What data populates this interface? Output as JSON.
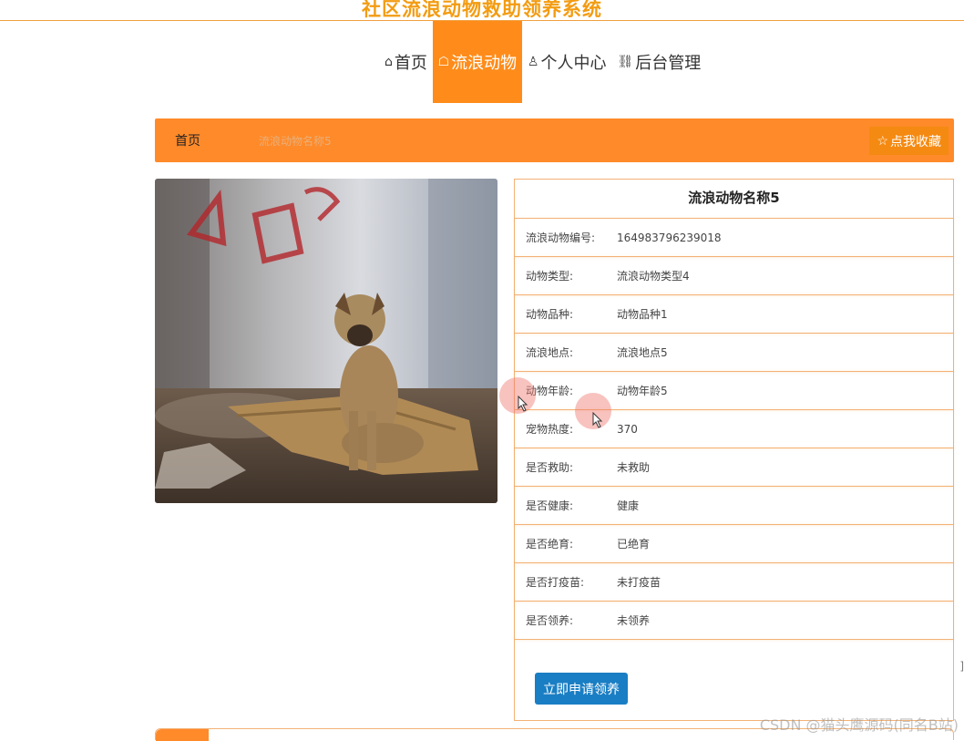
{
  "header": {
    "site_title": "社区流浪动物救助领养系统"
  },
  "nav": {
    "items": [
      {
        "label": "首页",
        "icon": "home-icon",
        "active": false
      },
      {
        "label": "流浪动物",
        "icon": "paw-icon",
        "active": true
      },
      {
        "label": "个人中心",
        "icon": "user-icon",
        "active": false
      },
      {
        "label": "后台管理",
        "icon": "link-icon",
        "active": false
      }
    ]
  },
  "breadcrumb": {
    "home": "首页",
    "current": "流浪动物名称5",
    "favorite_label": "点我收藏",
    "favorite_icon": "star-icon"
  },
  "detail": {
    "title": "流浪动物名称5",
    "rows": [
      {
        "label": "流浪动物编号:",
        "value": "164983796239018"
      },
      {
        "label": "动物类型:",
        "value": "流浪动物类型4"
      },
      {
        "label": "动物品种:",
        "value": "动物品种1"
      },
      {
        "label": "流浪地点:",
        "value": "流浪地点5"
      },
      {
        "label": "动物年龄:",
        "value": "动物年龄5"
      },
      {
        "label": "宠物热度:",
        "value": "370"
      },
      {
        "label": "是否救助:",
        "value": "未救助"
      },
      {
        "label": "是否健康:",
        "value": "健康"
      },
      {
        "label": "是否绝育:",
        "value": "已绝育"
      },
      {
        "label": "是否打疫苗:",
        "value": "未打疫苗"
      },
      {
        "label": "是否领养:",
        "value": "未领养"
      }
    ],
    "adopt_button": "立即申请领养"
  },
  "watermark": "CSDN @猫头鹰源码(同名B站)",
  "colors": {
    "accent": "#ff8c1a",
    "button_blue": "#1a7ec4",
    "title_orange": "#f39c12"
  }
}
